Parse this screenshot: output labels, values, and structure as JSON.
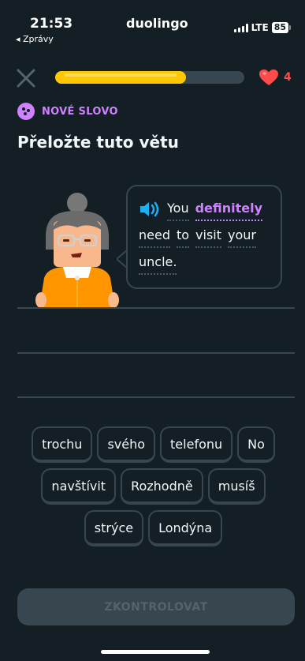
{
  "status_bar": {
    "time": "21:53",
    "back_app": "◂ Zprávy",
    "app_title": "duolingo",
    "network": "LTE",
    "battery": "85"
  },
  "progress": {
    "fraction": 0.69
  },
  "hearts": {
    "count": "4"
  },
  "lesson": {
    "badge_label": "NOVÉ SLOVO",
    "title": "Přeložte tuto větu"
  },
  "sentence": {
    "words": [
      "You",
      "definitely",
      "need",
      "to",
      "visit",
      "your",
      "uncle."
    ],
    "highlighted_word": "definitely"
  },
  "word_bank": {
    "row1": [
      "trochu",
      "svého",
      "telefonu",
      "No"
    ],
    "row2": [
      "navštívit",
      "Rozhodně",
      "musíš"
    ],
    "row3": [
      "strýce",
      "Londýna"
    ]
  },
  "actions": {
    "check_label": "ZKONTROLOVAT"
  },
  "colors": {
    "background": "#131f24",
    "accent_purple": "#ce82ff",
    "progress_yellow": "#ffc800",
    "heart_red": "#ff4b4b",
    "speaker_blue": "#1cb0f6"
  },
  "icons": [
    "close-icon",
    "heart-icon",
    "new-word-icon",
    "speaker-icon"
  ]
}
